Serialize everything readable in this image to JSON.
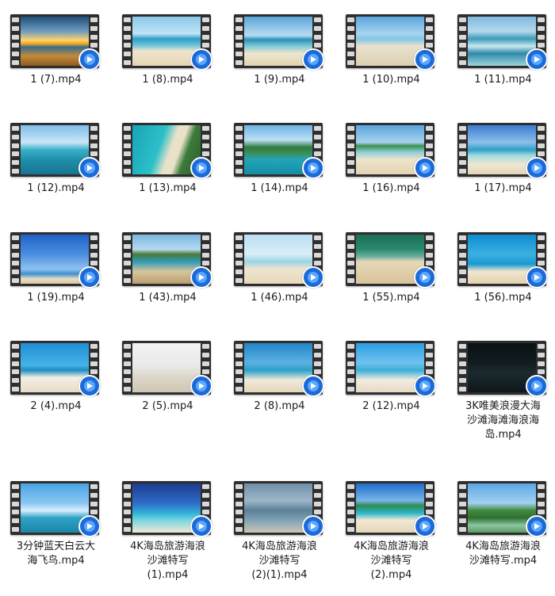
{
  "files": [
    {
      "name": "1 (7).mp4",
      "scene": "sunset",
      "icon": "video-file-icon"
    },
    {
      "name": "1 (8).mp4",
      "scene": "beach-day",
      "icon": "video-file-icon"
    },
    {
      "name": "1 (9).mp4",
      "scene": "beach-palm",
      "icon": "video-file-icon"
    },
    {
      "name": "1 (10).mp4",
      "scene": "beach-person",
      "icon": "video-file-icon"
    },
    {
      "name": "1 (11).mp4",
      "scene": "waves",
      "icon": "video-file-icon"
    },
    {
      "name": "1 (12).mp4",
      "scene": "turquoise-island",
      "icon": "video-file-icon"
    },
    {
      "name": "1 (13).mp4",
      "scene": "aerial-coast",
      "icon": "video-file-icon"
    },
    {
      "name": "1 (14).mp4",
      "scene": "green-island",
      "icon": "video-file-icon"
    },
    {
      "name": "1 (16).mp4",
      "scene": "shoreline",
      "icon": "video-file-icon"
    },
    {
      "name": "1 (17).mp4",
      "scene": "blue-sky-beach",
      "icon": "video-file-icon"
    },
    {
      "name": "1 (19).mp4",
      "scene": "blue-sky-people",
      "icon": "video-file-icon"
    },
    {
      "name": "1 (43).mp4",
      "scene": "palm-trees",
      "icon": "video-file-icon"
    },
    {
      "name": "1 (46).mp4",
      "scene": "beach-sitting",
      "icon": "video-file-icon"
    },
    {
      "name": "1 (55).mp4",
      "scene": "aerial-sand",
      "icon": "video-file-icon"
    },
    {
      "name": "1 (56).mp4",
      "scene": "umbrella",
      "icon": "video-file-icon"
    },
    {
      "name": "2 (4).mp4",
      "scene": "loungers",
      "icon": "video-file-icon"
    },
    {
      "name": "2 (5).mp4",
      "scene": "walking-woman",
      "icon": "video-file-icon"
    },
    {
      "name": "2 (8).mp4",
      "scene": "chairs-ocean",
      "icon": "video-file-icon"
    },
    {
      "name": "2 (12).mp4",
      "scene": "straw-umbrella",
      "icon": "video-file-icon"
    },
    {
      "name": "3K唯美浪漫大海沙滩海滩海浪海岛.mp4",
      "lines": [
        "3K唯美浪漫大海",
        "沙滩海滩海浪海",
        "岛.mp4"
      ],
      "scene": "dark-sea",
      "icon": "video-file-icon"
    },
    {
      "name": "3分钟蓝天白云大海飞鸟.mp4",
      "lines": [
        "3分钟蓝天白云大",
        "海飞鸟.mp4"
      ],
      "scene": "birds-pier",
      "icon": "video-file-icon"
    },
    {
      "name": "4K海岛旅游海浪沙滩特写 (1).mp4",
      "lines": [
        "4K海岛旅游海浪",
        "沙滩特写",
        "(1).mp4"
      ],
      "scene": "clear-water",
      "icon": "video-file-icon"
    },
    {
      "name": "4K海岛旅游海浪沙滩特写 (2)(1).mp4",
      "lines": [
        "4K海岛旅游海浪",
        "沙滩特写",
        "(2)(1).mp4"
      ],
      "scene": "gray-sea",
      "icon": "video-file-icon"
    },
    {
      "name": "4K海岛旅游海浪沙滩特写 (2).mp4",
      "lines": [
        "4K海岛旅游海浪",
        "沙滩特写",
        "(2).mp4"
      ],
      "scene": "curved-bay",
      "icon": "video-file-icon"
    },
    {
      "name": "4K海岛旅游海浪沙滩特写.mp4",
      "lines": [
        "4K海岛旅游海浪",
        "沙滩特写.mp4"
      ],
      "scene": "palm-resort",
      "icon": "video-file-icon"
    }
  ]
}
